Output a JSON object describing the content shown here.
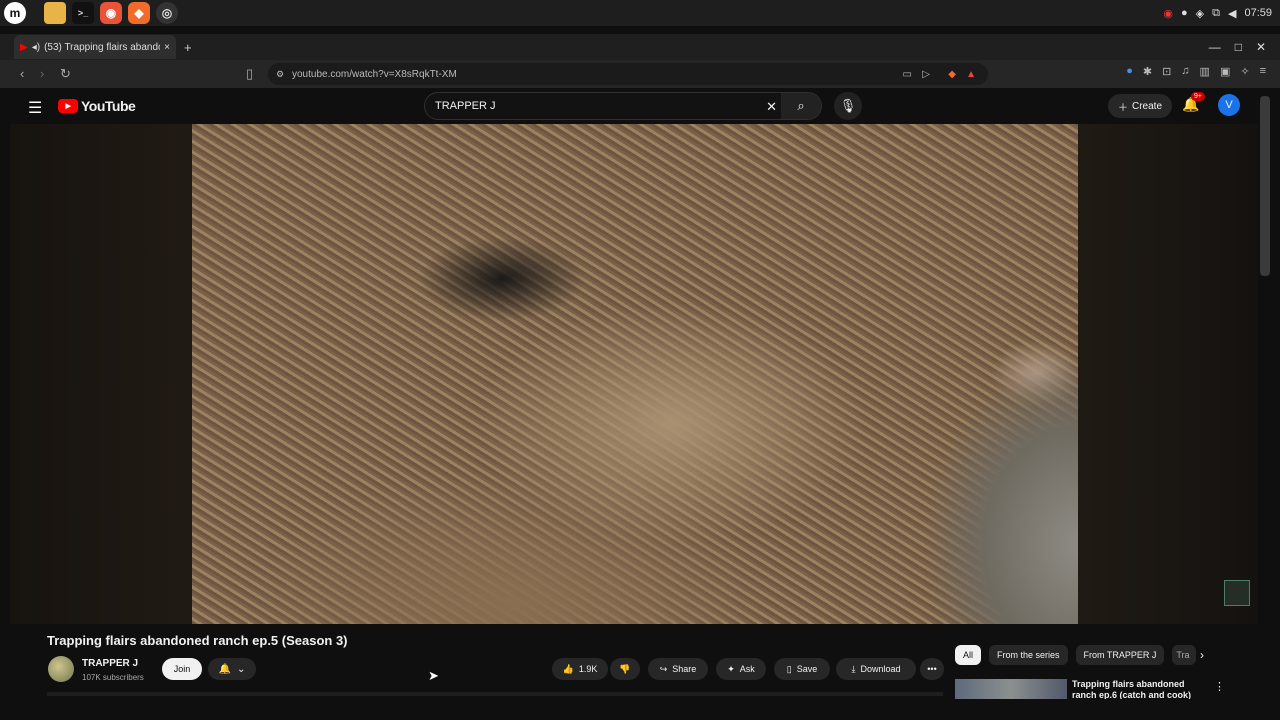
{
  "taskbar": {
    "apps": [
      {
        "name": "menu-icon",
        "glyph": "m"
      },
      {
        "name": "files-icon",
        "glyph": "▬"
      },
      {
        "name": "terminal-icon",
        "glyph": ">_"
      },
      {
        "name": "firefox-icon",
        "glyph": "◉"
      },
      {
        "name": "brave-icon",
        "glyph": "◆"
      },
      {
        "name": "chromium-icon",
        "glyph": "◎"
      }
    ],
    "clock": "07:59"
  },
  "browser": {
    "tab_title": "(53) Trapping flairs abando",
    "url": "youtube.com/watch?v=X8sRqkTt-XM",
    "new_tab": "+",
    "close_tab": "×"
  },
  "youtube": {
    "logo_text": "YouTube",
    "search_value": "TRAPPER J",
    "create_label": "Create",
    "notification_count": "9+",
    "avatar_letter": "V"
  },
  "video": {
    "title": "Trapping flairs abandoned ranch ep.5 (Season 3)",
    "channel": "TRAPPER J",
    "subscribers": "107K subscribers",
    "join_label": "Join",
    "likes": "1.9K",
    "share_label": "Share",
    "ask_label": "Ask",
    "save_label": "Save",
    "download_label": "Download"
  },
  "filters": {
    "chips": [
      "All",
      "From the series",
      "From TRAPPER J",
      "Tra"
    ]
  },
  "recommendation": {
    "title": "Trapping flairs abandoned ranch ep.6 (catch and cook)"
  }
}
